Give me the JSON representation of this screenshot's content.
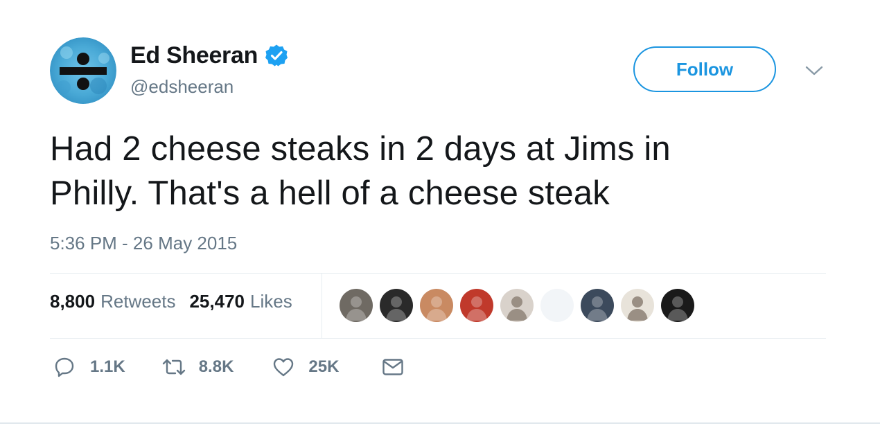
{
  "colors": {
    "primary_text": "#14171a",
    "secondary_text": "#657786",
    "accent_blue": "#1b95e0",
    "divider": "#e6ecf0"
  },
  "author": {
    "display_name": "Ed Sheeran",
    "handle": "@edsheeran",
    "verified": true,
    "avatar_icon": "divide-album-avatar",
    "avatar_text": "÷ / ÷ / ÷ / ÷"
  },
  "header": {
    "follow_label": "Follow",
    "menu_icon": "chevron-down-icon"
  },
  "tweet": {
    "line1": "Had 2 cheese steaks in 2 days at Jims in",
    "line2": "Philly. That's a hell of a cheese steak",
    "timestamp": "5:36 PM - 26 May 2015"
  },
  "stats": {
    "retweets_count": "8,800",
    "retweets_label": "Retweets",
    "likes_count": "25,470",
    "likes_label": "Likes"
  },
  "likers": [
    {
      "name": "liker-avatar-1",
      "bg": "#6f6a63"
    },
    {
      "name": "liker-avatar-2",
      "bg": "#2a2a2a"
    },
    {
      "name": "liker-avatar-3",
      "bg": "#c98a62"
    },
    {
      "name": "liker-avatar-4",
      "bg": "#c0392b"
    },
    {
      "name": "liker-avatar-5",
      "bg": "#d9d2cb"
    },
    {
      "name": "liker-avatar-6",
      "bg": "#f2f5f8"
    },
    {
      "name": "liker-avatar-7",
      "bg": "#3c4a5c"
    },
    {
      "name": "liker-avatar-8",
      "bg": "#e8e3da"
    },
    {
      "name": "liker-avatar-9",
      "bg": "#1a1a1a"
    }
  ],
  "actions": {
    "reply_count": "1.1K",
    "retweet_count": "8.8K",
    "like_count": "25K",
    "icons": [
      "reply-icon",
      "retweet-icon",
      "heart-icon",
      "envelope-icon"
    ]
  }
}
